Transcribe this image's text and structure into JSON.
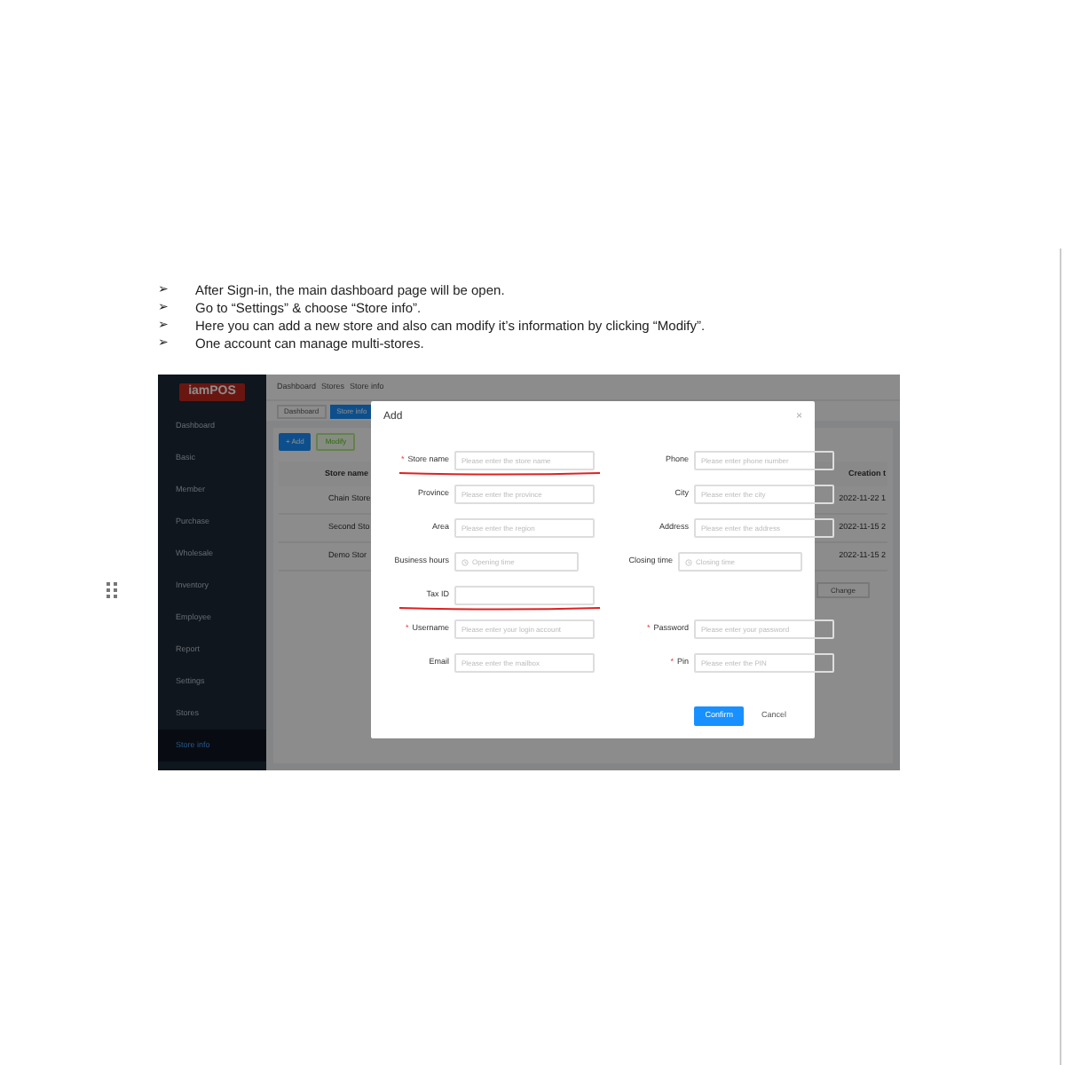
{
  "bullets": [
    {
      "marker": "➢",
      "text": "After Sign-in, the main dashboard page will be open."
    },
    {
      "marker": "➢",
      "text": "Go to “Settings” & choose “Store info”."
    },
    {
      "marker": "➢",
      "text": "Here you can add a new store and also can modify it’s information by clicking “Modify”."
    },
    {
      "marker": "➢",
      "text": "One account can manage multi-stores."
    }
  ],
  "screenshot": {
    "logo": "iamPOS",
    "sidebar": {
      "items": [
        {
          "label": "Dashboard",
          "selected": false
        },
        {
          "label": "Basic",
          "selected": false
        },
        {
          "label": "Member",
          "selected": false
        },
        {
          "label": "Purchase",
          "selected": false
        },
        {
          "label": "Wholesale",
          "selected": false
        },
        {
          "label": "Inventory",
          "selected": false
        },
        {
          "label": "Employee",
          "selected": false
        },
        {
          "label": "Report",
          "selected": false
        },
        {
          "label": "Settings",
          "selected": false
        },
        {
          "label": "Stores",
          "selected": false
        },
        {
          "label": "Store info",
          "selected": true
        }
      ]
    },
    "breadcrumb": [
      "Dashboard",
      "Stores",
      "Store info"
    ],
    "tabs": [
      {
        "label": "Dashboard",
        "selected": false
      },
      {
        "label": "Store info",
        "selected": true
      }
    ],
    "toolbar": [
      "+ Add",
      "Modify"
    ],
    "table": {
      "columns": [
        "Store name",
        "Creation t"
      ],
      "rows": [
        [
          "Chain Store",
          "2022-11-22 1"
        ],
        [
          "Second Sto",
          "2022-11-15 2"
        ],
        [
          "Demo Stor",
          "2022-11-15 2"
        ]
      ]
    },
    "change_button": "Change",
    "modal": {
      "title": "Add",
      "close": "×",
      "rows": [
        [
          {
            "label": "Store name",
            "required_mark": "*",
            "kind": "input",
            "placeholder": "Please enter the store name",
            "marked": true
          },
          {
            "label": "Phone",
            "kind": "input",
            "placeholder": "Please enter phone number"
          }
        ],
        [
          {
            "label": "Province",
            "kind": "input",
            "placeholder": "Please enter the province"
          },
          {
            "label": "City",
            "kind": "input",
            "placeholder": "Please enter the city"
          }
        ],
        [
          {
            "label": "Area",
            "kind": "input",
            "placeholder": "Please enter the region"
          },
          {
            "label": "Address",
            "kind": "input",
            "placeholder": "Please enter the address"
          }
        ],
        [
          {
            "label": "Business hours",
            "kind": "time",
            "placeholder": "Opening time"
          },
          {
            "label": "Closing time",
            "kind": "time",
            "placeholder": "Closing time"
          }
        ],
        [
          {
            "label": "Tax ID",
            "kind": "input",
            "marked": true
          }
        ],
        [
          {
            "label": "Username",
            "required_mark": "*",
            "kind": "input",
            "placeholder": "Please enter your login account"
          },
          {
            "label": "Password",
            "required_mark": "*",
            "kind": "input",
            "placeholder": "Please enter your password"
          }
        ],
        [
          {
            "label": "Email",
            "kind": "input",
            "placeholder": "Please enter the mailbox"
          },
          {
            "label": "Pin",
            "required_mark": "*",
            "kind": "input",
            "placeholder": "Please enter the PIN"
          }
        ]
      ],
      "buttons": [
        "Confirm",
        "Cancel"
      ]
    }
  }
}
